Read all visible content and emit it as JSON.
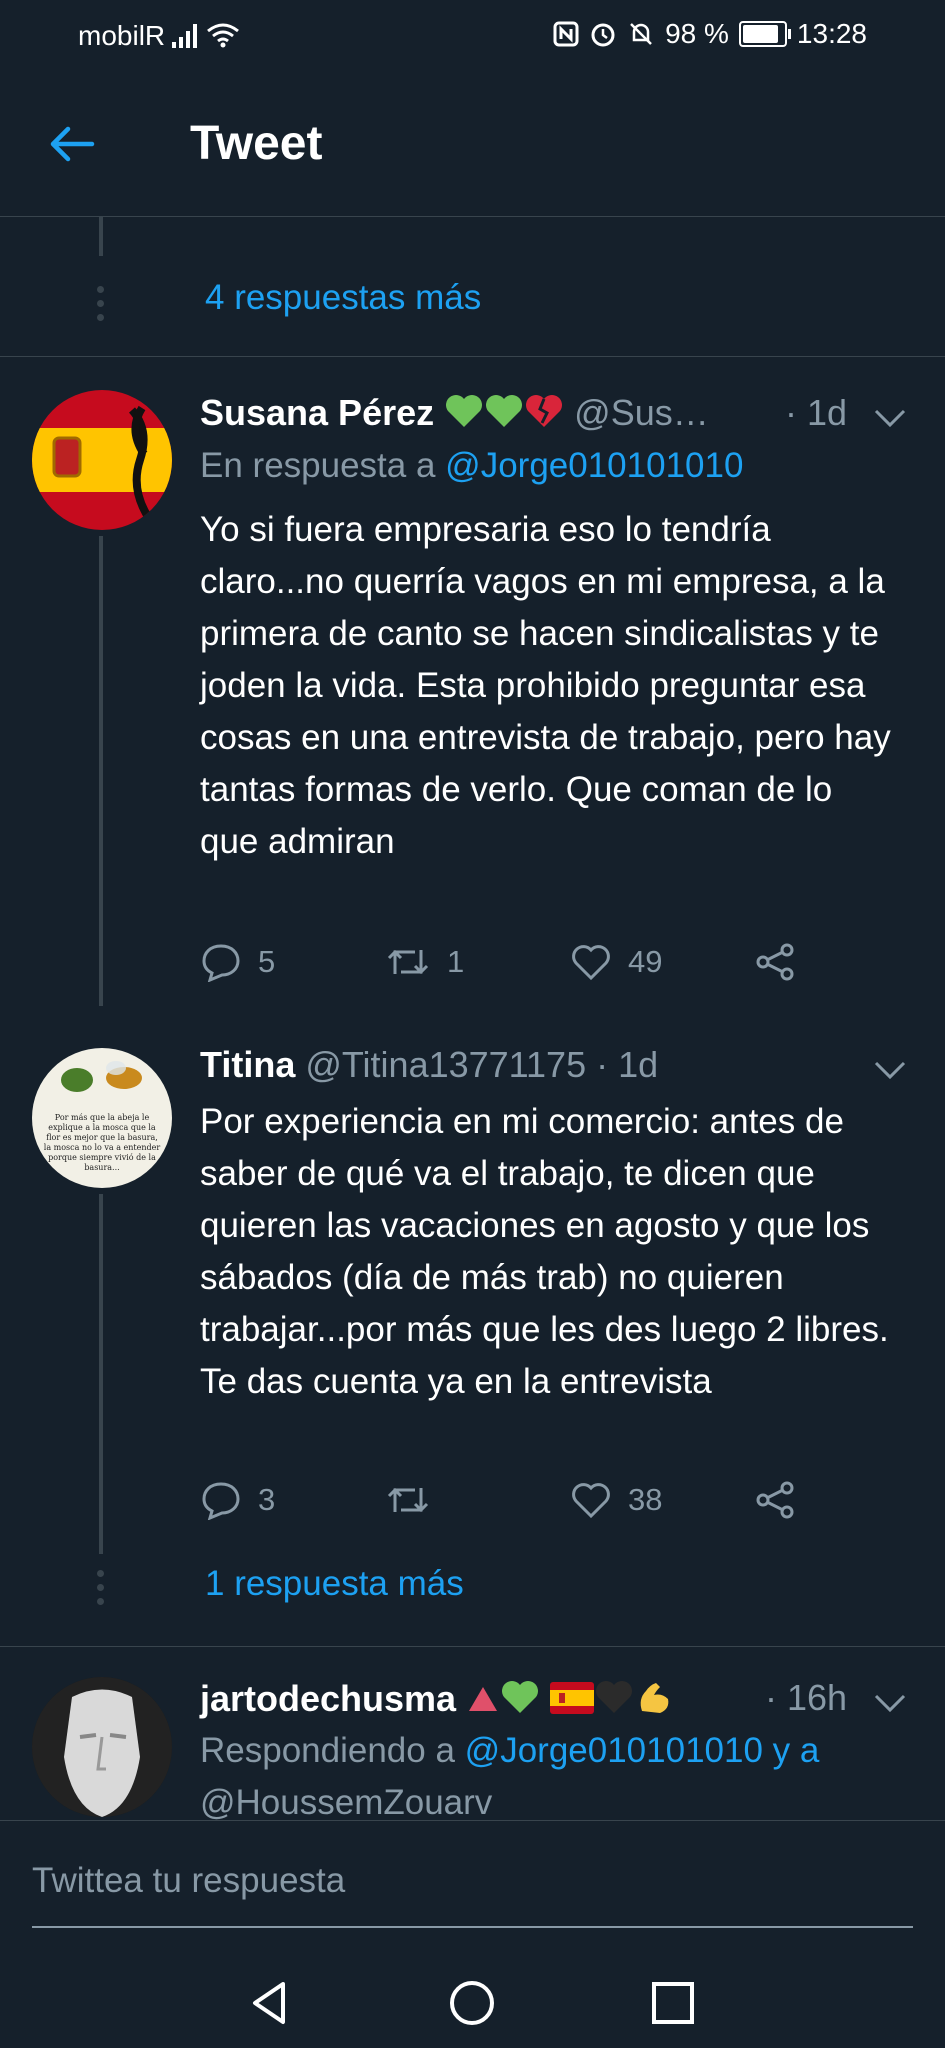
{
  "status": {
    "carrier": "mobilR",
    "battery": "98 %",
    "battery_level": 0.98,
    "time": "13:28"
  },
  "header": {
    "title": "Tweet",
    "back_icon": "arrow-left-icon"
  },
  "top": {
    "more_replies": "4 respuestas más"
  },
  "colors": {
    "background": "#15202b",
    "accent": "#1da1f2",
    "muted": "#8899a6",
    "divider": "#38444d"
  },
  "tweets": [
    {
      "name": "Susana Pérez",
      "handle": "@Sus…",
      "time": "· 1d",
      "reply_prefix": "En respuesta a",
      "reply_to": "@Jorge010101010",
      "text": "Yo si fuera empresaria eso lo tendría claro...no querría vagos en mi empresa, a la primera de canto se hacen sindicalistas y te joden la vida. Esta prohibido preguntar esa cosas en una entrevista de trabajo, pero hay tantas formas de verlo. Que coman de lo que admiran",
      "replies": "5",
      "retweets": "1",
      "likes": "49"
    },
    {
      "name": "Titina",
      "handle": "@Titina13771175",
      "time": "· 1d",
      "avatar_text": "Por más que la abeja le explique a la mosca que la flor es mejor que la basura, la mosca no lo va a entender porque siempre vivió de la basura...",
      "text": "Por experiencia en mi comercio: antes de saber  de qué va el trabajo, te dicen que quieren las vacaciones en agosto y que los sábados (día de más trab) no quieren trabajar...por más que les des luego 2 libres. Te das cuenta ya en la entrevista",
      "replies": "3",
      "retweets": "",
      "likes": "38",
      "more_replies": "1 respuesta más"
    },
    {
      "name": "jartodechusma",
      "time": "· 16h",
      "reply_prefix": "Respondiendo a",
      "reply_to": "@Jorge010101010 y a",
      "reply_to2": "@HoussemZouarv"
    }
  ],
  "composer": {
    "placeholder": "Twittea tu respuesta"
  }
}
